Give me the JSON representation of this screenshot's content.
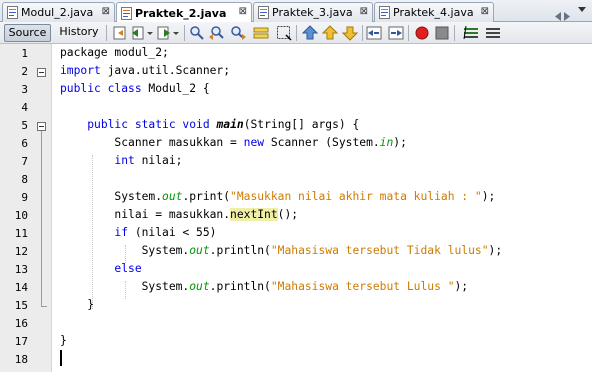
{
  "tabs": [
    {
      "name": "Modul_2.java",
      "active": false
    },
    {
      "name": "Praktek_2.java",
      "active": true
    },
    {
      "name": "Praktek_3.java",
      "active": false
    },
    {
      "name": "Praktek_4.java",
      "active": false
    }
  ],
  "tab_close_glyph": "⊠",
  "toolbar": {
    "source_label": "Source",
    "history_label": "History"
  },
  "editor": {
    "line_numbers": [
      "1",
      "2",
      "3",
      "4",
      "5",
      "6",
      "7",
      "8",
      "9",
      "10",
      "11",
      "12",
      "13",
      "14",
      "15",
      "16",
      "17",
      "18"
    ],
    "lines": [
      [
        {
          "t": "package modul_2;",
          "c": ""
        }
      ],
      [
        {
          "t": "import",
          "c": "kw"
        },
        {
          "t": " java.util.Scanner;",
          "c": ""
        }
      ],
      [
        {
          "t": "public class",
          "c": "kw"
        },
        {
          "t": " Modul_2 {",
          "c": ""
        }
      ],
      [],
      [
        {
          "t": "    ",
          "c": ""
        },
        {
          "t": "public static void",
          "c": "kw"
        },
        {
          "t": " ",
          "c": ""
        },
        {
          "t": "main",
          "c": "it"
        },
        {
          "t": "(String[] args) {",
          "c": ""
        }
      ],
      [
        {
          "t": "        Scanner masukkan = ",
          "c": ""
        },
        {
          "t": "new",
          "c": "kw"
        },
        {
          "t": " Scanner (System.",
          "c": ""
        },
        {
          "t": "in",
          "c": "fld"
        },
        {
          "t": ");",
          "c": ""
        }
      ],
      [
        {
          "t": "        ",
          "c": ""
        },
        {
          "t": "int",
          "c": "kw"
        },
        {
          "t": " nilai;",
          "c": ""
        }
      ],
      [],
      [
        {
          "t": "        System.",
          "c": ""
        },
        {
          "t": "out",
          "c": "fld"
        },
        {
          "t": ".print(",
          "c": ""
        },
        {
          "t": "\"Masukkan nilai akhir mata kuliah : \"",
          "c": "str"
        },
        {
          "t": ");",
          "c": ""
        }
      ],
      [
        {
          "t": "        nilai = masukkan.",
          "c": ""
        },
        {
          "t": "nextInt",
          "c": "hl"
        },
        {
          "t": "();",
          "c": ""
        }
      ],
      [
        {
          "t": "        ",
          "c": ""
        },
        {
          "t": "if",
          "c": "kw"
        },
        {
          "t": " (nilai < 55)",
          "c": ""
        }
      ],
      [
        {
          "t": "            System.",
          "c": ""
        },
        {
          "t": "out",
          "c": "fld"
        },
        {
          "t": ".println(",
          "c": ""
        },
        {
          "t": "\"Mahasiswa tersebut Tidak lulus\"",
          "c": "str"
        },
        {
          "t": ");",
          "c": ""
        }
      ],
      [
        {
          "t": "        ",
          "c": ""
        },
        {
          "t": "else",
          "c": "kw"
        }
      ],
      [
        {
          "t": "            System.",
          "c": ""
        },
        {
          "t": "out",
          "c": "fld"
        },
        {
          "t": ".println(",
          "c": ""
        },
        {
          "t": "\"Mahasiswa tersebut Lulus \"",
          "c": "str"
        },
        {
          "t": ");",
          "c": ""
        }
      ],
      [
        {
          "t": "    }",
          "c": ""
        }
      ],
      [],
      [
        {
          "t": "}",
          "c": ""
        }
      ],
      []
    ]
  },
  "colors": {
    "keyword": "#0000e6",
    "string": "#ce7b00",
    "static_field": "#009900",
    "occurrence_highlight": "#f0efa8"
  }
}
